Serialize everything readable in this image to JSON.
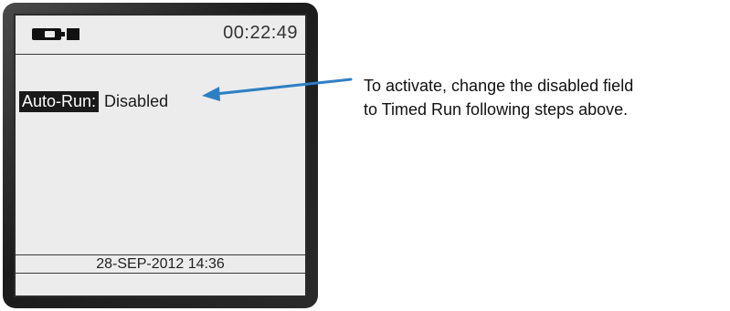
{
  "device": {
    "status_bar": {
      "battery_icon": "battery-icon",
      "indicator_icon": "square-indicator-icon",
      "time": "00:22:49"
    },
    "field": {
      "label": "Auto-Run:",
      "value": "Disabled"
    },
    "footer": {
      "datetime": "28-SEP-2012   14:36"
    },
    "colors": {
      "screen_bg": "#ececec",
      "bezel": "#1b1b1b",
      "label_bg": "#1a1a1a"
    }
  },
  "callout": {
    "line1": "To activate, change the disabled field",
    "line2": "to Timed Run following steps above.",
    "arrow_color": "#2f7fc4"
  }
}
